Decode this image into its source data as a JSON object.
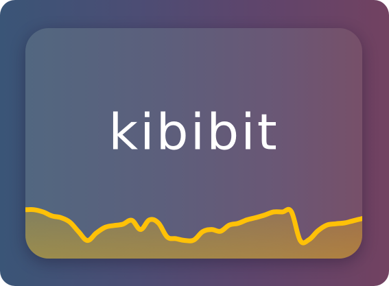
{
  "brand": {
    "name": "kibibit"
  },
  "colors": {
    "background_left": "#3a5577",
    "background_right": "#724261",
    "card_left": "#526780",
    "card_right": "#775069",
    "line": "#ffc107",
    "fill_bottom": "#a07a3e"
  },
  "chart_data": {
    "type": "area",
    "values": [
      0.8,
      0.8,
      0.75,
      0.66,
      0.62,
      0.52,
      0.3,
      0.1,
      0.27,
      0.4,
      0.44,
      0.47,
      0.56,
      0.35,
      0.57,
      0.5,
      0.18,
      0.14,
      0.1,
      0.11,
      0.3,
      0.35,
      0.31,
      0.45,
      0.49,
      0.57,
      0.62,
      0.68,
      0.75,
      0.75,
      0.76,
      0.1,
      0.12,
      0.32,
      0.45,
      0.48,
      0.5,
      0.55,
      0.6
    ]
  }
}
